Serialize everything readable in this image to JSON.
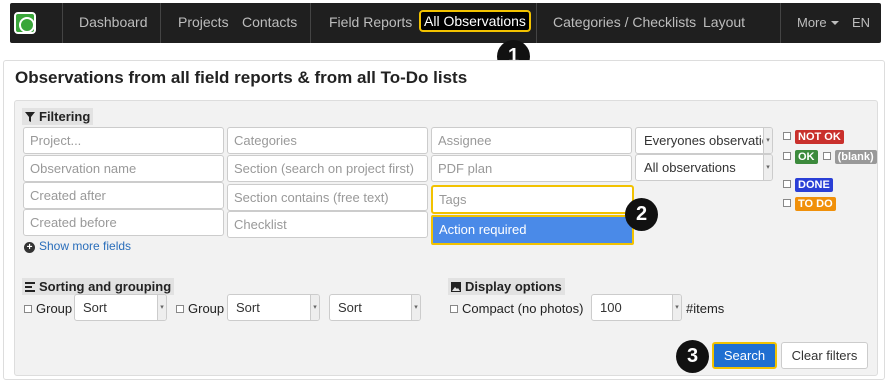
{
  "nav": {
    "items": [
      "Dashboard",
      "Projects",
      "Contacts",
      "Field Reports",
      "All Observations",
      "Categories / Checklists",
      "Layout"
    ],
    "more": "More",
    "language": "EN"
  },
  "callouts": [
    "1",
    "2",
    "3"
  ],
  "page": {
    "title": "Observations from all field reports & from all To-Do lists"
  },
  "filtering": {
    "label": "Filtering",
    "fields": {
      "project": "Project...",
      "observation_name": "Observation name",
      "created_after": "Created after",
      "created_before": "Created before",
      "categories": "Categories",
      "section_search": "Section (search on project first)",
      "section_contains": "Section contains (free text)",
      "checklist": "Checklist",
      "assignee": "Assignee",
      "pdf_plan": "PDF plan",
      "tags": "Tags"
    },
    "dropdown_option": "Action required",
    "show_more": "Show more fields",
    "observer_select": "Everyones observatio",
    "observations_select": "All observations",
    "statuses": {
      "not_ok": "NOT OK",
      "ok": "OK",
      "blank": "(blank)",
      "done": "DONE",
      "todo": "TO DO"
    },
    "status_colors": {
      "not_ok": "#c9302c",
      "ok": "#3c8a3c",
      "blank": "#999999",
      "done": "#2a3fd6",
      "todo": "#f0900a"
    }
  },
  "sorting": {
    "label": "Sorting and grouping",
    "group1": "Group",
    "sort1": "Sort",
    "group2": "Group",
    "sort2": "Sort",
    "sort3": "Sort"
  },
  "display": {
    "label": "Display options",
    "compact": "Compact (no photos)",
    "items_value": "100",
    "items_label": "#items"
  },
  "buttons": {
    "search": "Search",
    "clear": "Clear filters"
  },
  "colors": {
    "highlight": "#f2c200",
    "primary": "#1f6fd1",
    "navbar": "#1f1f1f"
  }
}
